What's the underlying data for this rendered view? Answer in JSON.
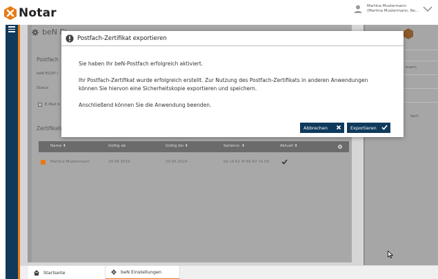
{
  "app": {
    "logo_text": "Notar",
    "brand_color": "#e87a14",
    "nav_color": "#0f3a5c"
  },
  "user": {
    "line1": "Martina Mustermann",
    "line2": "(Martina Mustermann, Re..."
  },
  "page": {
    "title": "beN Ei",
    "section_postfach": "Postfach",
    "egvp_label": "beN EGVP (",
    "status_label": "Status",
    "email_label": "E-Mail b",
    "section_zertifikate": "Zertifikate"
  },
  "table": {
    "headers": [
      "Name ⬍",
      "Gültig ab",
      "Gültig bis ⬍",
      "Seriennr. ⬍",
      "Aktuell ⬍"
    ],
    "rows": [
      {
        "name": "Martina Mustermann",
        "valid_from": "29.05.2019",
        "valid_to": "29.05.2024",
        "serial": "0e c4 62 4f 80 62 7a 00"
      }
    ]
  },
  "right_panel": {
    "item1": "euern",
    "item2": "fach"
  },
  "dialog": {
    "title": "Postfach-Zertifikat exportieren",
    "para1": "Sie haben Ihr beN-Postfach erfolgreich aktiviert.",
    "para2": "Ihr Postfach-Zertifikat wurde erfolgreich erstellt. Zur Nutzung des Postfach-Zertifikats in anderen Anwendungen können Sie hiervon eine Sicherheitskopie exportieren und speichern.",
    "para3": "Anschließend können Sie die Anwendung beenden.",
    "cancel_label": "Abbrechen",
    "export_label": "Exportieren"
  },
  "tabs": [
    {
      "label": "Startseite",
      "icon": "home-icon"
    },
    {
      "label": "beN Einstellungen",
      "icon": "gear-icon"
    }
  ]
}
